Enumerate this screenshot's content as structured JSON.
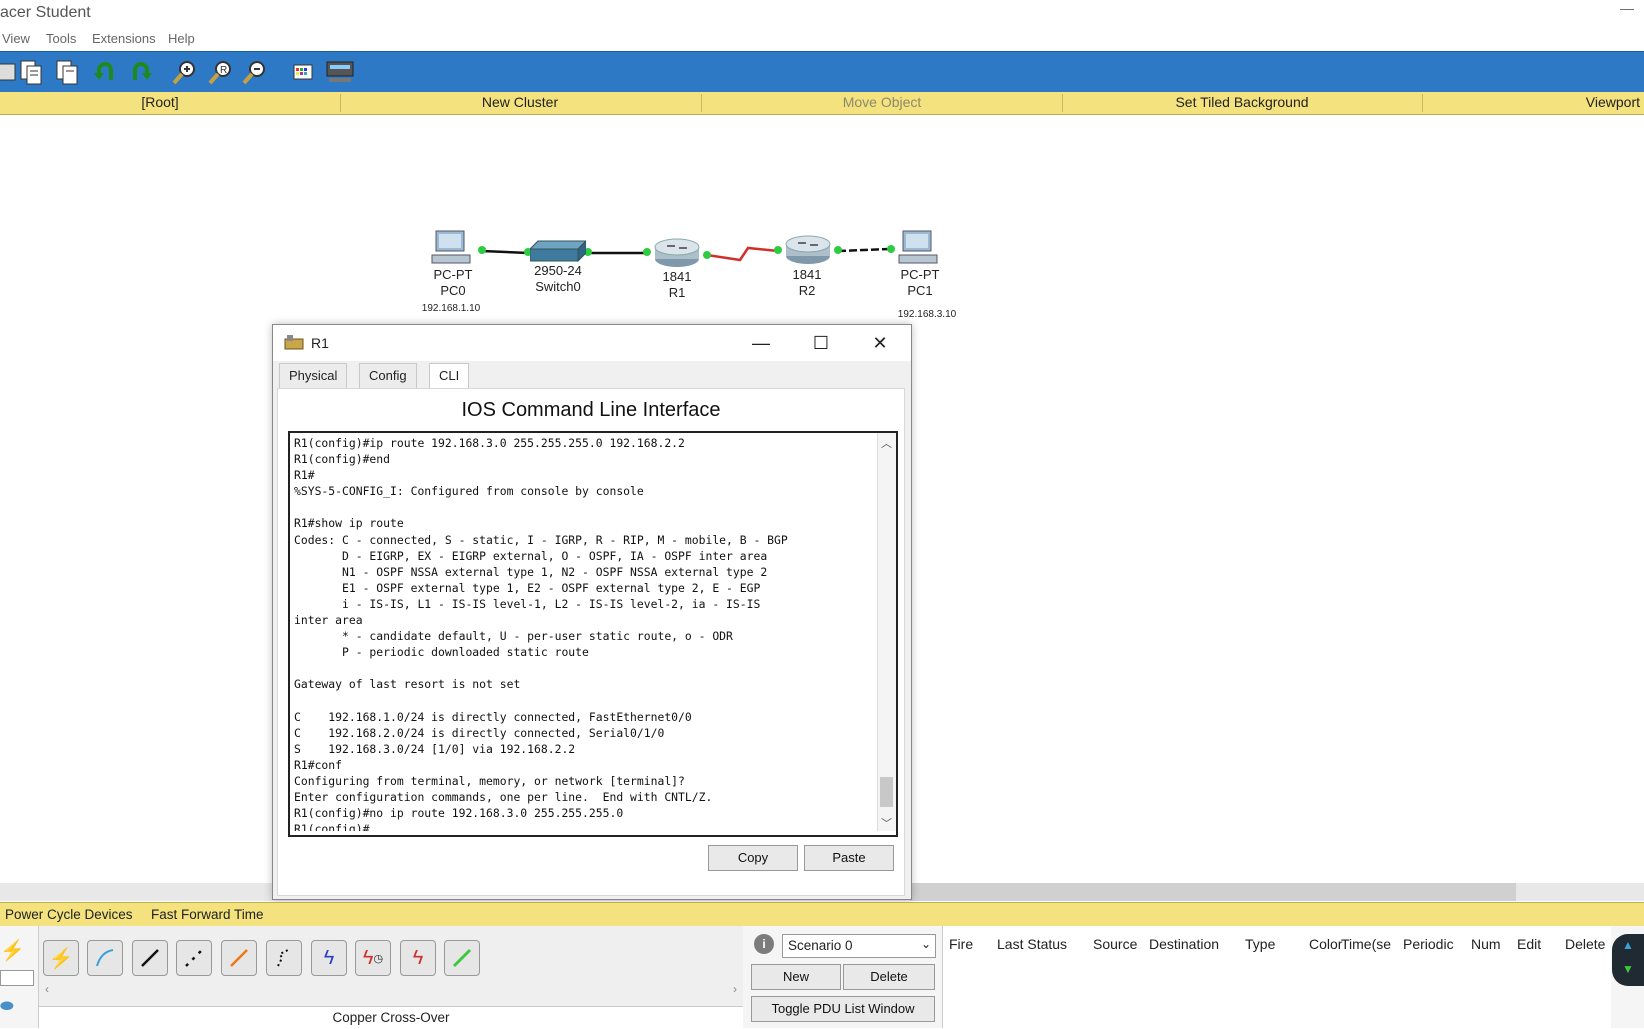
{
  "app": {
    "title": "acer Student"
  },
  "menu": [
    "View",
    "Tools",
    "Extensions",
    "Help"
  ],
  "workbar": {
    "root": "[Root]",
    "new_cluster": "New Cluster",
    "move_object": "Move Object",
    "set_tiled_background": "Set Tiled Background",
    "viewport": "Viewport"
  },
  "devices": {
    "pc0": {
      "type": "PC-PT",
      "name": "PC0",
      "ip": "192.168.1.10"
    },
    "switch0": {
      "type": "2950-24",
      "name": "Switch0"
    },
    "r1": {
      "type": "1841",
      "name": "R1"
    },
    "r2": {
      "type": "1841",
      "name": "R2"
    },
    "pc1": {
      "type": "PC-PT",
      "name": "PC1",
      "ip": "192.168.3.10"
    }
  },
  "r1_window": {
    "title": "R1",
    "tabs": [
      "Physical",
      "Config",
      "CLI"
    ],
    "active_tab": "CLI",
    "heading": "IOS Command Line Interface",
    "cli_output": "R1(config)#ip route 192.168.3.0 255.255.255.0 192.168.2.2\nR1(config)#end\nR1#\n%SYS-5-CONFIG_I: Configured from console by console\n\nR1#show ip route\nCodes: C - connected, S - static, I - IGRP, R - RIP, M - mobile, B - BGP\n       D - EIGRP, EX - EIGRP external, O - OSPF, IA - OSPF inter area\n       N1 - OSPF NSSA external type 1, N2 - OSPF NSSA external type 2\n       E1 - OSPF external type 1, E2 - OSPF external type 2, E - EGP\n       i - IS-IS, L1 - IS-IS level-1, L2 - IS-IS level-2, ia - IS-IS\ninter area\n       * - candidate default, U - per-user static route, o - ODR\n       P - periodic downloaded static route\n\nGateway of last resort is not set\n\nC    192.168.1.0/24 is directly connected, FastEthernet0/0\nC    192.168.2.0/24 is directly connected, Serial0/1/0\nS    192.168.3.0/24 [1/0] via 192.168.2.2\nR1#conf\nConfiguring from terminal, memory, or network [terminal]?\nEnter configuration commands, one per line.  End with CNTL/Z.\nR1(config)#no ip route 192.168.3.0 255.255.255.0\nR1(config)#",
    "copy_label": "Copy",
    "paste_label": "Paste"
  },
  "bottom": {
    "power_cycle": "Power Cycle Devices",
    "fast_forward": "Fast Forward Time",
    "connection_type": "Copper Cross-Over",
    "scenario": "Scenario 0",
    "new_label": "New",
    "delete_label": "Delete",
    "toggle_pdu": "Toggle PDU List Window",
    "pdu_columns": [
      "Fire",
      "Last Status",
      "Source",
      "Destination",
      "Type",
      "Color",
      "Time(se",
      "Periodic",
      "Num",
      "Edit",
      "Delete"
    ]
  },
  "colors": {
    "toolbar_blue": "#2e79c6",
    "workbar_yellow": "#f4e27e",
    "link_green": "#2ecc40",
    "serial_red": "#d0302a"
  }
}
